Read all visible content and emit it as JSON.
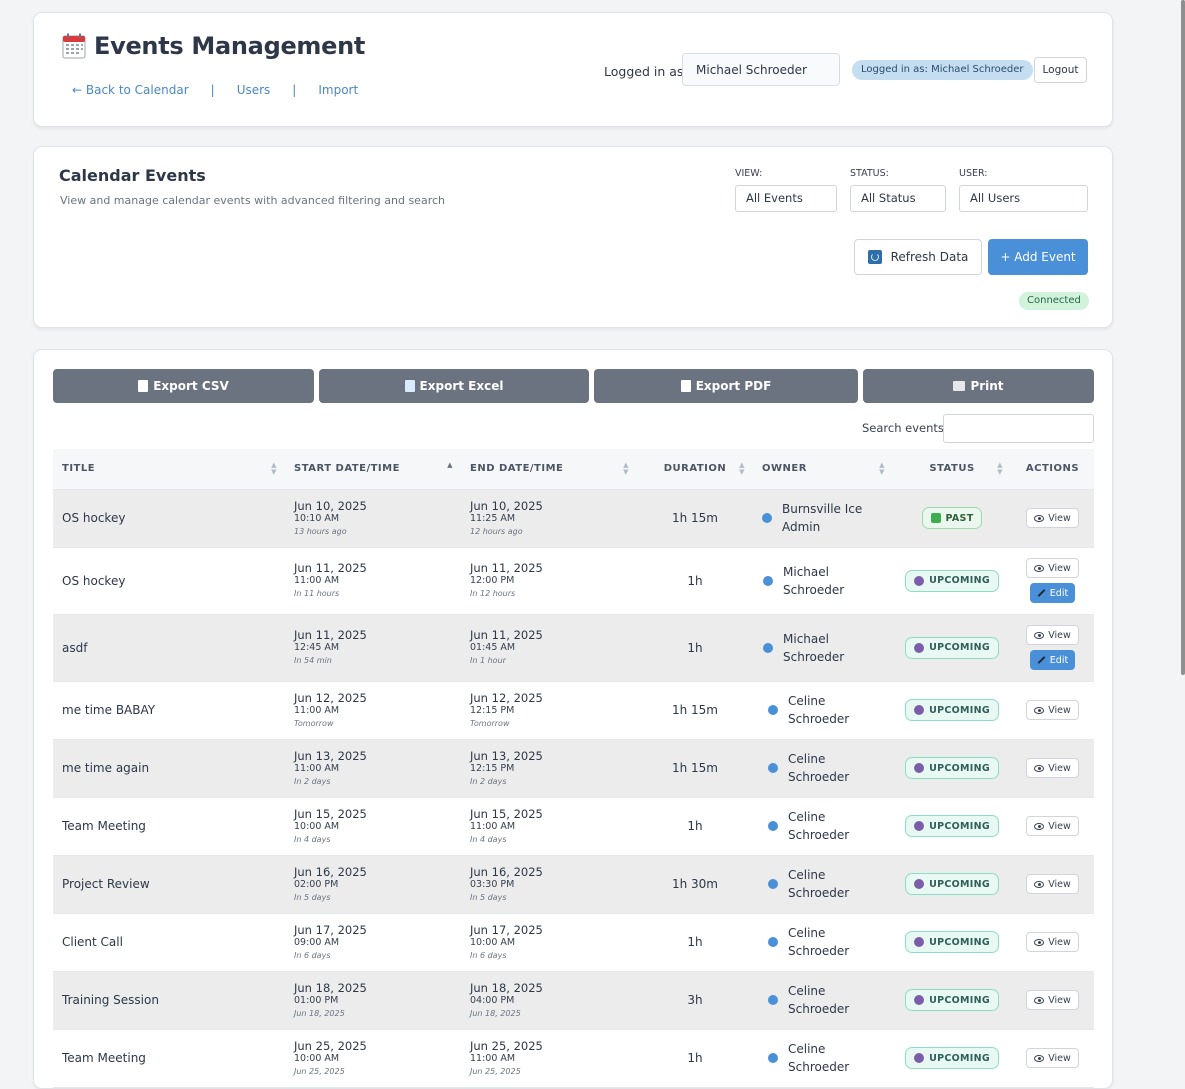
{
  "header": {
    "title": "Events Management",
    "nav": {
      "back": "← Back to Calendar",
      "users": "Users",
      "import": "Import",
      "separator": "|"
    },
    "logged_in_label": "Logged in as",
    "logged_in_value": "Michael Schroeder",
    "logged_in_badge": "Logged in as: Michael Schroeder",
    "logout": "Logout"
  },
  "filters": {
    "title": "Calendar Events",
    "subtitle": "View and manage calendar events with advanced filtering and search",
    "view_label": "VIEW:",
    "view_value": "All Events",
    "status_label": "STATUS:",
    "status_value": "All Status",
    "user_label": "USER:",
    "user_value": "All Users",
    "refresh": "Refresh Data",
    "add": "+ Add Event",
    "connection": "Connected"
  },
  "exports": {
    "csv": "Export CSV",
    "excel": "Export Excel",
    "pdf": "Export PDF",
    "print": "Print"
  },
  "search": {
    "label": "Search events:",
    "value": ""
  },
  "table": {
    "columns": {
      "title": "TITLE",
      "start": "START DATE/TIME",
      "end": "END DATE/TIME",
      "duration": "DURATION",
      "owner": "OWNER",
      "status": "STATUS",
      "actions": "ACTIONS"
    },
    "view_label": "View",
    "edit_label": "Edit",
    "rows": [
      {
        "title": "OS hockey",
        "start_date": "Jun 10, 2025",
        "start_time": "10:10 AM",
        "start_rel": "13 hours ago",
        "end_date": "Jun 10, 2025",
        "end_time": "11:25 AM",
        "end_rel": "12 hours ago",
        "duration": "1h 15m",
        "owner": "Burnsville Ice Admin",
        "status": "PAST"
      },
      {
        "title": "OS hockey",
        "start_date": "Jun 11, 2025",
        "start_time": "11:00 AM",
        "start_rel": "In 11 hours",
        "end_date": "Jun 11, 2025",
        "end_time": "12:00 PM",
        "end_rel": "In 12 hours",
        "duration": "1h",
        "owner": "Michael Schroeder",
        "status": "UPCOMING"
      },
      {
        "title": "asdf",
        "start_date": "Jun 11, 2025",
        "start_time": "12:45 AM",
        "start_rel": "In 54 min",
        "end_date": "Jun 11, 2025",
        "end_time": "01:45 AM",
        "end_rel": "In 1 hour",
        "duration": "1h",
        "owner": "Michael Schroeder",
        "status": "UPCOMING"
      },
      {
        "title": "me time BABAY",
        "start_date": "Jun 12, 2025",
        "start_time": "11:00 AM",
        "start_rel": "Tomorrow",
        "end_date": "Jun 12, 2025",
        "end_time": "12:15 PM",
        "end_rel": "Tomorrow",
        "duration": "1h 15m",
        "owner": "Celine Schroeder",
        "status": "UPCOMING"
      },
      {
        "title": "me time again",
        "start_date": "Jun 13, 2025",
        "start_time": "11:00 AM",
        "start_rel": "In 2 days",
        "end_date": "Jun 13, 2025",
        "end_time": "12:15 PM",
        "end_rel": "In 2 days",
        "duration": "1h 15m",
        "owner": "Celine Schroeder",
        "status": "UPCOMING"
      },
      {
        "title": "Team Meeting",
        "start_date": "Jun 15, 2025",
        "start_time": "10:00 AM",
        "start_rel": "In 4 days",
        "end_date": "Jun 15, 2025",
        "end_time": "11:00 AM",
        "end_rel": "In 4 days",
        "duration": "1h",
        "owner": "Celine Schroeder",
        "status": "UPCOMING"
      },
      {
        "title": "Project Review",
        "start_date": "Jun 16, 2025",
        "start_time": "02:00 PM",
        "start_rel": "In 5 days",
        "end_date": "Jun 16, 2025",
        "end_time": "03:30 PM",
        "end_rel": "In 5 days",
        "duration": "1h 30m",
        "owner": "Celine Schroeder",
        "status": "UPCOMING"
      },
      {
        "title": "Client Call",
        "start_date": "Jun 17, 2025",
        "start_time": "09:00 AM",
        "start_rel": "In 6 days",
        "end_date": "Jun 17, 2025",
        "end_time": "10:00 AM",
        "end_rel": "In 6 days",
        "duration": "1h",
        "owner": "Celine Schroeder",
        "status": "UPCOMING"
      },
      {
        "title": "Training Session",
        "start_date": "Jun 18, 2025",
        "start_time": "01:00 PM",
        "start_rel": "Jun 18, 2025",
        "end_date": "Jun 18, 2025",
        "end_time": "04:00 PM",
        "end_rel": "Jun 18, 2025",
        "duration": "3h",
        "owner": "Celine Schroeder",
        "status": "UPCOMING"
      },
      {
        "title": "Team Meeting",
        "start_date": "Jun 25, 2025",
        "start_time": "10:00 AM",
        "start_rel": "Jun 25, 2025",
        "end_date": "Jun 25, 2025",
        "end_time": "11:00 AM",
        "end_rel": "Jun 25, 2025",
        "duration": "1h",
        "owner": "Celine Schroeder",
        "status": "UPCOMING"
      }
    ]
  }
}
